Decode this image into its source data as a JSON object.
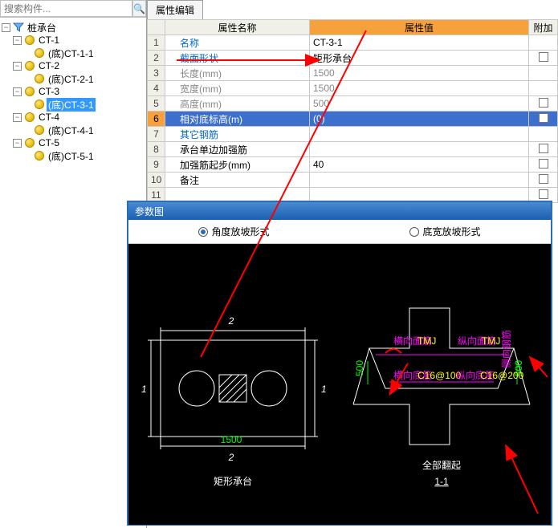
{
  "search": {
    "placeholder": "搜索构件..."
  },
  "tree": {
    "root": "桩承台",
    "items": [
      {
        "label": "CT-1",
        "children": [
          "(底)CT-1-1"
        ]
      },
      {
        "label": "CT-2",
        "children": [
          "(底)CT-2-1"
        ]
      },
      {
        "label": "CT-3",
        "children": [
          "(底)CT-3-1"
        ],
        "selectedChild": 0
      },
      {
        "label": "CT-4",
        "children": [
          "(底)CT-4-1"
        ]
      },
      {
        "label": "CT-5",
        "children": [
          "(底)CT-5-1"
        ]
      }
    ]
  },
  "tab": {
    "title": "属性编辑"
  },
  "table": {
    "headers": {
      "name": "属性名称",
      "value": "属性值",
      "extra": "附加"
    },
    "rows": [
      {
        "n": "1",
        "name": "名称",
        "value": "CT-3-1",
        "link": true
      },
      {
        "n": "2",
        "name": "截面形状",
        "value": "矩形承台",
        "link": true,
        "chk": true
      },
      {
        "n": "3",
        "name": "长度(mm)",
        "value": "1500",
        "gray": true
      },
      {
        "n": "4",
        "name": "宽度(mm)",
        "value": "1500",
        "gray": true
      },
      {
        "n": "5",
        "name": "高度(mm)",
        "value": "500",
        "gray": true,
        "chk": true
      },
      {
        "n": "6",
        "name": "相对底标高(m)",
        "value": "(0)",
        "sel": true,
        "chk": true
      },
      {
        "n": "7",
        "name": "其它钢筋",
        "value": "",
        "link": true
      },
      {
        "n": "8",
        "name": "承台单边加强筋",
        "value": "",
        "chk": true
      },
      {
        "n": "9",
        "name": "加强筋起步(mm)",
        "value": "40",
        "chk": true
      },
      {
        "n": "10",
        "name": "备注",
        "value": "",
        "chk": true
      },
      {
        "n": "11",
        "name": "",
        "value": "",
        "gray": true,
        "chk": true
      }
    ]
  },
  "diagram": {
    "title": "参数图",
    "radio1": "角度放坡形式",
    "radio2": "底宽放坡形式",
    "labels": {
      "rect_top": "2",
      "rect_bottom": "2",
      "rect_left": "1",
      "rect_right": "1",
      "rect_caption": "矩形承台",
      "section_caption": "全部翻起",
      "section_sub": "1-1",
      "dim": "1500",
      "heng_mj": "横向面筋",
      "zong_mj": "纵向面筋",
      "tmj": "TMJ",
      "heng_dj": "横向底筋",
      "c16_1": "C16@100",
      "zong_dj": "纵向底筋",
      "c16_2": "C16@200"
    }
  }
}
